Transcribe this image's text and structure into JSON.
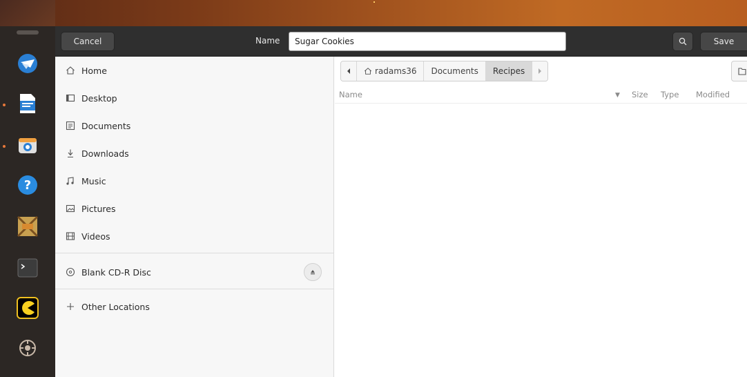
{
  "header": {
    "cancel_label": "Cancel",
    "name_label": "Name",
    "filename_value": "Sugar Cookies",
    "save_label": "Save",
    "search_icon": "search-icon"
  },
  "sidebar": {
    "items": [
      {
        "label": "Home",
        "icon": "home-icon"
      },
      {
        "label": "Desktop",
        "icon": "desktop-icon"
      },
      {
        "label": "Documents",
        "icon": "documents-icon"
      },
      {
        "label": "Downloads",
        "icon": "downloads-icon"
      },
      {
        "label": "Music",
        "icon": "music-icon"
      },
      {
        "label": "Pictures",
        "icon": "pictures-icon"
      },
      {
        "label": "Videos",
        "icon": "videos-icon"
      }
    ],
    "devices": [
      {
        "label": "Blank CD-R Disc",
        "icon": "disc-icon"
      }
    ],
    "other_locations_label": "Other Locations"
  },
  "pathbar": {
    "segments": [
      "radams36",
      "Documents",
      "Recipes"
    ],
    "active_index": 2
  },
  "columns": {
    "name": "Name",
    "size": "Size",
    "type": "Type",
    "modified": "Modified"
  },
  "colors": {
    "header_bg": "#2f2f2f",
    "sidebar_bg": "#f7f7f7",
    "dock_bg": "#2c2724",
    "accent": "#e8783a"
  }
}
